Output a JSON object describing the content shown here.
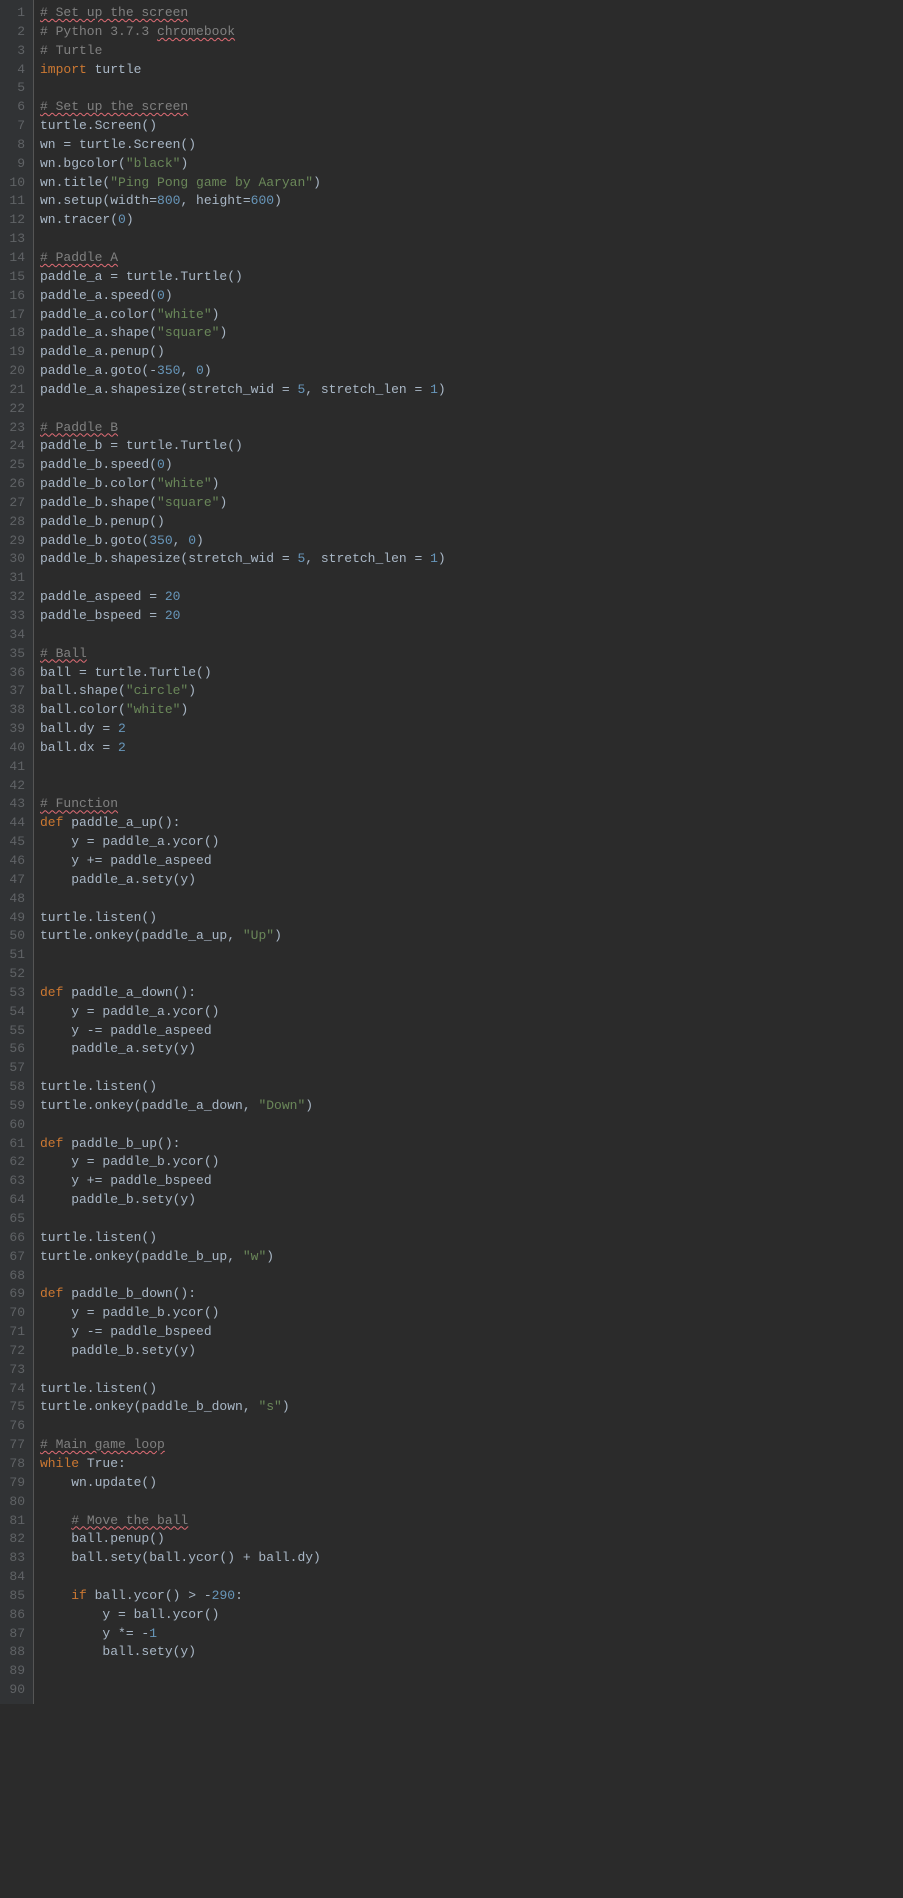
{
  "lines": [
    {
      "n": 1,
      "tokens": [
        [
          "# Set up the screen",
          "comment squiggle"
        ]
      ]
    },
    {
      "n": 2,
      "tokens": [
        [
          "# Python 3.7.3 ",
          "comment"
        ],
        [
          "chromebook",
          "comment squiggle"
        ]
      ]
    },
    {
      "n": 3,
      "tokens": [
        [
          "# Turtle",
          "comment"
        ]
      ]
    },
    {
      "n": 4,
      "tokens": [
        [
          "import",
          "keyword"
        ],
        [
          " turtle",
          ""
        ]
      ]
    },
    {
      "n": 5,
      "tokens": [
        [
          "",
          ""
        ]
      ]
    },
    {
      "n": 6,
      "tokens": [
        [
          "# Set up the screen",
          "comment squiggle"
        ]
      ]
    },
    {
      "n": 7,
      "tokens": [
        [
          "turtle.Screen()",
          ""
        ]
      ]
    },
    {
      "n": 8,
      "tokens": [
        [
          "wn = turtle.Screen()",
          ""
        ]
      ]
    },
    {
      "n": 9,
      "tokens": [
        [
          "wn.bgcolor(",
          ""
        ],
        [
          "\"black\"",
          "string"
        ],
        [
          ")",
          ""
        ]
      ]
    },
    {
      "n": 10,
      "tokens": [
        [
          "wn.title(",
          ""
        ],
        [
          "\"Ping Pong game by Aaryan\"",
          "string"
        ],
        [
          ")",
          ""
        ]
      ]
    },
    {
      "n": 11,
      "tokens": [
        [
          "wn.setup(width=",
          ""
        ],
        [
          "800",
          "number"
        ],
        [
          ", height=",
          ""
        ],
        [
          "600",
          "number"
        ],
        [
          ")",
          ""
        ]
      ]
    },
    {
      "n": 12,
      "tokens": [
        [
          "wn.tracer(",
          ""
        ],
        [
          "0",
          "number"
        ],
        [
          ")",
          ""
        ]
      ]
    },
    {
      "n": 13,
      "tokens": [
        [
          "",
          ""
        ]
      ]
    },
    {
      "n": 14,
      "tokens": [
        [
          "# Paddle A",
          "comment squiggle"
        ]
      ]
    },
    {
      "n": 15,
      "tokens": [
        [
          "paddle_a = turtle.Turtle()",
          ""
        ]
      ]
    },
    {
      "n": 16,
      "tokens": [
        [
          "paddle_a.speed(",
          ""
        ],
        [
          "0",
          "number"
        ],
        [
          ")",
          ""
        ]
      ]
    },
    {
      "n": 17,
      "tokens": [
        [
          "paddle_a.color(",
          ""
        ],
        [
          "\"white\"",
          "string"
        ],
        [
          ")",
          ""
        ]
      ]
    },
    {
      "n": 18,
      "tokens": [
        [
          "paddle_a.shape(",
          ""
        ],
        [
          "\"square\"",
          "string"
        ],
        [
          ")",
          ""
        ]
      ]
    },
    {
      "n": 19,
      "tokens": [
        [
          "paddle_a.penup()",
          ""
        ]
      ]
    },
    {
      "n": 20,
      "tokens": [
        [
          "paddle_a.goto(-",
          ""
        ],
        [
          "350",
          "number"
        ],
        [
          ", ",
          ""
        ],
        [
          "0",
          "number"
        ],
        [
          ")",
          ""
        ]
      ]
    },
    {
      "n": 21,
      "tokens": [
        [
          "paddle_a.shapesize(stretch_wid = ",
          ""
        ],
        [
          "5",
          "number"
        ],
        [
          ", stretch_len = ",
          ""
        ],
        [
          "1",
          "number"
        ],
        [
          ")",
          ""
        ]
      ]
    },
    {
      "n": 22,
      "tokens": [
        [
          "",
          ""
        ]
      ]
    },
    {
      "n": 23,
      "tokens": [
        [
          "# Paddle B",
          "comment squiggle"
        ]
      ]
    },
    {
      "n": 24,
      "tokens": [
        [
          "paddle_b = turtle.Turtle()",
          ""
        ]
      ]
    },
    {
      "n": 25,
      "tokens": [
        [
          "paddle_b.speed(",
          ""
        ],
        [
          "0",
          "number"
        ],
        [
          ")",
          ""
        ]
      ]
    },
    {
      "n": 26,
      "tokens": [
        [
          "paddle_b.color(",
          ""
        ],
        [
          "\"white\"",
          "string"
        ],
        [
          ")",
          ""
        ]
      ]
    },
    {
      "n": 27,
      "tokens": [
        [
          "paddle_b.shape(",
          ""
        ],
        [
          "\"square\"",
          "string"
        ],
        [
          ")",
          ""
        ]
      ]
    },
    {
      "n": 28,
      "tokens": [
        [
          "paddle_b.penup()",
          ""
        ]
      ]
    },
    {
      "n": 29,
      "tokens": [
        [
          "paddle_b.goto(",
          ""
        ],
        [
          "350",
          "number"
        ],
        [
          ", ",
          ""
        ],
        [
          "0",
          "number"
        ],
        [
          ")",
          ""
        ]
      ]
    },
    {
      "n": 30,
      "tokens": [
        [
          "paddle_b.shapesize(stretch_wid = ",
          ""
        ],
        [
          "5",
          "number"
        ],
        [
          ", stretch_len = ",
          ""
        ],
        [
          "1",
          "number"
        ],
        [
          ")",
          ""
        ]
      ]
    },
    {
      "n": 31,
      "tokens": [
        [
          "",
          ""
        ]
      ]
    },
    {
      "n": 32,
      "tokens": [
        [
          "paddle_aspeed = ",
          ""
        ],
        [
          "20",
          "number"
        ]
      ]
    },
    {
      "n": 33,
      "tokens": [
        [
          "paddle_bspeed = ",
          ""
        ],
        [
          "20",
          "number"
        ]
      ]
    },
    {
      "n": 34,
      "tokens": [
        [
          "",
          ""
        ]
      ]
    },
    {
      "n": 35,
      "tokens": [
        [
          "# Ball",
          "comment squiggle"
        ]
      ]
    },
    {
      "n": 36,
      "tokens": [
        [
          "ball = turtle.Turtle()",
          ""
        ]
      ]
    },
    {
      "n": 37,
      "tokens": [
        [
          "ball.shape(",
          ""
        ],
        [
          "\"circle\"",
          "string"
        ],
        [
          ")",
          ""
        ]
      ]
    },
    {
      "n": 38,
      "tokens": [
        [
          "ball.color(",
          ""
        ],
        [
          "\"white\"",
          "string"
        ],
        [
          ")",
          ""
        ]
      ]
    },
    {
      "n": 39,
      "tokens": [
        [
          "ball.dy = ",
          ""
        ],
        [
          "2",
          "number"
        ]
      ]
    },
    {
      "n": 40,
      "tokens": [
        [
          "ball.dx = ",
          ""
        ],
        [
          "2",
          "number"
        ]
      ]
    },
    {
      "n": 41,
      "tokens": [
        [
          "",
          ""
        ]
      ]
    },
    {
      "n": 42,
      "tokens": [
        [
          "",
          ""
        ]
      ]
    },
    {
      "n": 43,
      "tokens": [
        [
          "# Function",
          "comment squiggle"
        ]
      ]
    },
    {
      "n": 44,
      "tokens": [
        [
          "def ",
          "keyword"
        ],
        [
          "paddle_a_up():",
          ""
        ]
      ]
    },
    {
      "n": 45,
      "tokens": [
        [
          "    y = paddle_a.ycor()",
          ""
        ]
      ]
    },
    {
      "n": 46,
      "tokens": [
        [
          "    y += paddle_aspeed",
          ""
        ]
      ]
    },
    {
      "n": 47,
      "tokens": [
        [
          "    paddle_a.sety(y)",
          ""
        ]
      ]
    },
    {
      "n": 48,
      "tokens": [
        [
          "",
          ""
        ]
      ]
    },
    {
      "n": 49,
      "tokens": [
        [
          "turtle.listen()",
          ""
        ]
      ]
    },
    {
      "n": 50,
      "tokens": [
        [
          "turtle.onkey(paddle_a_up, ",
          ""
        ],
        [
          "\"Up\"",
          "string"
        ],
        [
          ")",
          ""
        ]
      ]
    },
    {
      "n": 51,
      "tokens": [
        [
          "",
          ""
        ]
      ]
    },
    {
      "n": 52,
      "tokens": [
        [
          "",
          ""
        ]
      ]
    },
    {
      "n": 53,
      "tokens": [
        [
          "def ",
          "keyword"
        ],
        [
          "paddle_a_down():",
          ""
        ]
      ]
    },
    {
      "n": 54,
      "tokens": [
        [
          "    y = paddle_a.ycor()",
          ""
        ]
      ]
    },
    {
      "n": 55,
      "tokens": [
        [
          "    y -= paddle_aspeed",
          ""
        ]
      ]
    },
    {
      "n": 56,
      "tokens": [
        [
          "    paddle_a.sety(y)",
          ""
        ]
      ]
    },
    {
      "n": 57,
      "tokens": [
        [
          "",
          ""
        ]
      ]
    },
    {
      "n": 58,
      "tokens": [
        [
          "turtle.listen()",
          ""
        ]
      ]
    },
    {
      "n": 59,
      "tokens": [
        [
          "turtle.onkey(paddle_a_down, ",
          ""
        ],
        [
          "\"Down\"",
          "string"
        ],
        [
          ")",
          ""
        ]
      ]
    },
    {
      "n": 60,
      "tokens": [
        [
          "",
          ""
        ]
      ]
    },
    {
      "n": 61,
      "tokens": [
        [
          "def ",
          "keyword"
        ],
        [
          "paddle_b_up():",
          ""
        ]
      ]
    },
    {
      "n": 62,
      "tokens": [
        [
          "    y = paddle_b.ycor()",
          ""
        ]
      ]
    },
    {
      "n": 63,
      "tokens": [
        [
          "    y += paddle_bspeed",
          ""
        ]
      ]
    },
    {
      "n": 64,
      "tokens": [
        [
          "    paddle_b.sety(y)",
          ""
        ]
      ]
    },
    {
      "n": 65,
      "tokens": [
        [
          "",
          ""
        ]
      ]
    },
    {
      "n": 66,
      "tokens": [
        [
          "turtle.listen()",
          ""
        ]
      ]
    },
    {
      "n": 67,
      "tokens": [
        [
          "turtle.onkey(paddle_b_up, ",
          ""
        ],
        [
          "\"w\"",
          "string"
        ],
        [
          ")",
          ""
        ]
      ]
    },
    {
      "n": 68,
      "tokens": [
        [
          "",
          ""
        ]
      ]
    },
    {
      "n": 69,
      "tokens": [
        [
          "def ",
          "keyword"
        ],
        [
          "paddle_b_down():",
          ""
        ]
      ]
    },
    {
      "n": 70,
      "tokens": [
        [
          "    y = paddle_b.ycor()",
          ""
        ]
      ]
    },
    {
      "n": 71,
      "tokens": [
        [
          "    y -= paddle_bspeed",
          ""
        ]
      ]
    },
    {
      "n": 72,
      "tokens": [
        [
          "    paddle_b.sety(y)",
          ""
        ]
      ]
    },
    {
      "n": 73,
      "tokens": [
        [
          "",
          ""
        ]
      ]
    },
    {
      "n": 74,
      "tokens": [
        [
          "turtle.listen()",
          ""
        ]
      ]
    },
    {
      "n": 75,
      "tokens": [
        [
          "turtle.onkey(paddle_b_down, ",
          ""
        ],
        [
          "\"s\"",
          "string"
        ],
        [
          ")",
          ""
        ]
      ]
    },
    {
      "n": 76,
      "tokens": [
        [
          "",
          ""
        ]
      ]
    },
    {
      "n": 77,
      "tokens": [
        [
          "# Main game loop",
          "comment squiggle"
        ]
      ]
    },
    {
      "n": 78,
      "tokens": [
        [
          "while ",
          "keyword"
        ],
        [
          "True",
          ""
        ],
        [
          ":",
          ""
        ]
      ]
    },
    {
      "n": 79,
      "tokens": [
        [
          "    wn.update()",
          ""
        ]
      ]
    },
    {
      "n": 80,
      "tokens": [
        [
          "",
          ""
        ]
      ]
    },
    {
      "n": 81,
      "tokens": [
        [
          "    ",
          ""
        ],
        [
          "# Move the ball",
          "comment squiggle"
        ]
      ]
    },
    {
      "n": 82,
      "tokens": [
        [
          "    ball.penup()",
          ""
        ]
      ]
    },
    {
      "n": 83,
      "tokens": [
        [
          "    ball.sety(ball.ycor() + ball.dy)",
          ""
        ]
      ]
    },
    {
      "n": 84,
      "tokens": [
        [
          "",
          ""
        ]
      ]
    },
    {
      "n": 85,
      "tokens": [
        [
          "    ",
          ""
        ],
        [
          "if ",
          "keyword"
        ],
        [
          "ball.ycor() > -",
          ""
        ],
        [
          "290",
          "number"
        ],
        [
          ":",
          ""
        ]
      ]
    },
    {
      "n": 86,
      "tokens": [
        [
          "        y = ball.ycor()",
          ""
        ]
      ]
    },
    {
      "n": 87,
      "tokens": [
        [
          "        y *= -",
          ""
        ],
        [
          "1",
          "number"
        ]
      ]
    },
    {
      "n": 88,
      "tokens": [
        [
          "        ball.sety(y)",
          ""
        ]
      ]
    },
    {
      "n": 89,
      "tokens": [
        [
          "",
          ""
        ]
      ]
    },
    {
      "n": 90,
      "tokens": [
        [
          "",
          ""
        ]
      ]
    }
  ]
}
